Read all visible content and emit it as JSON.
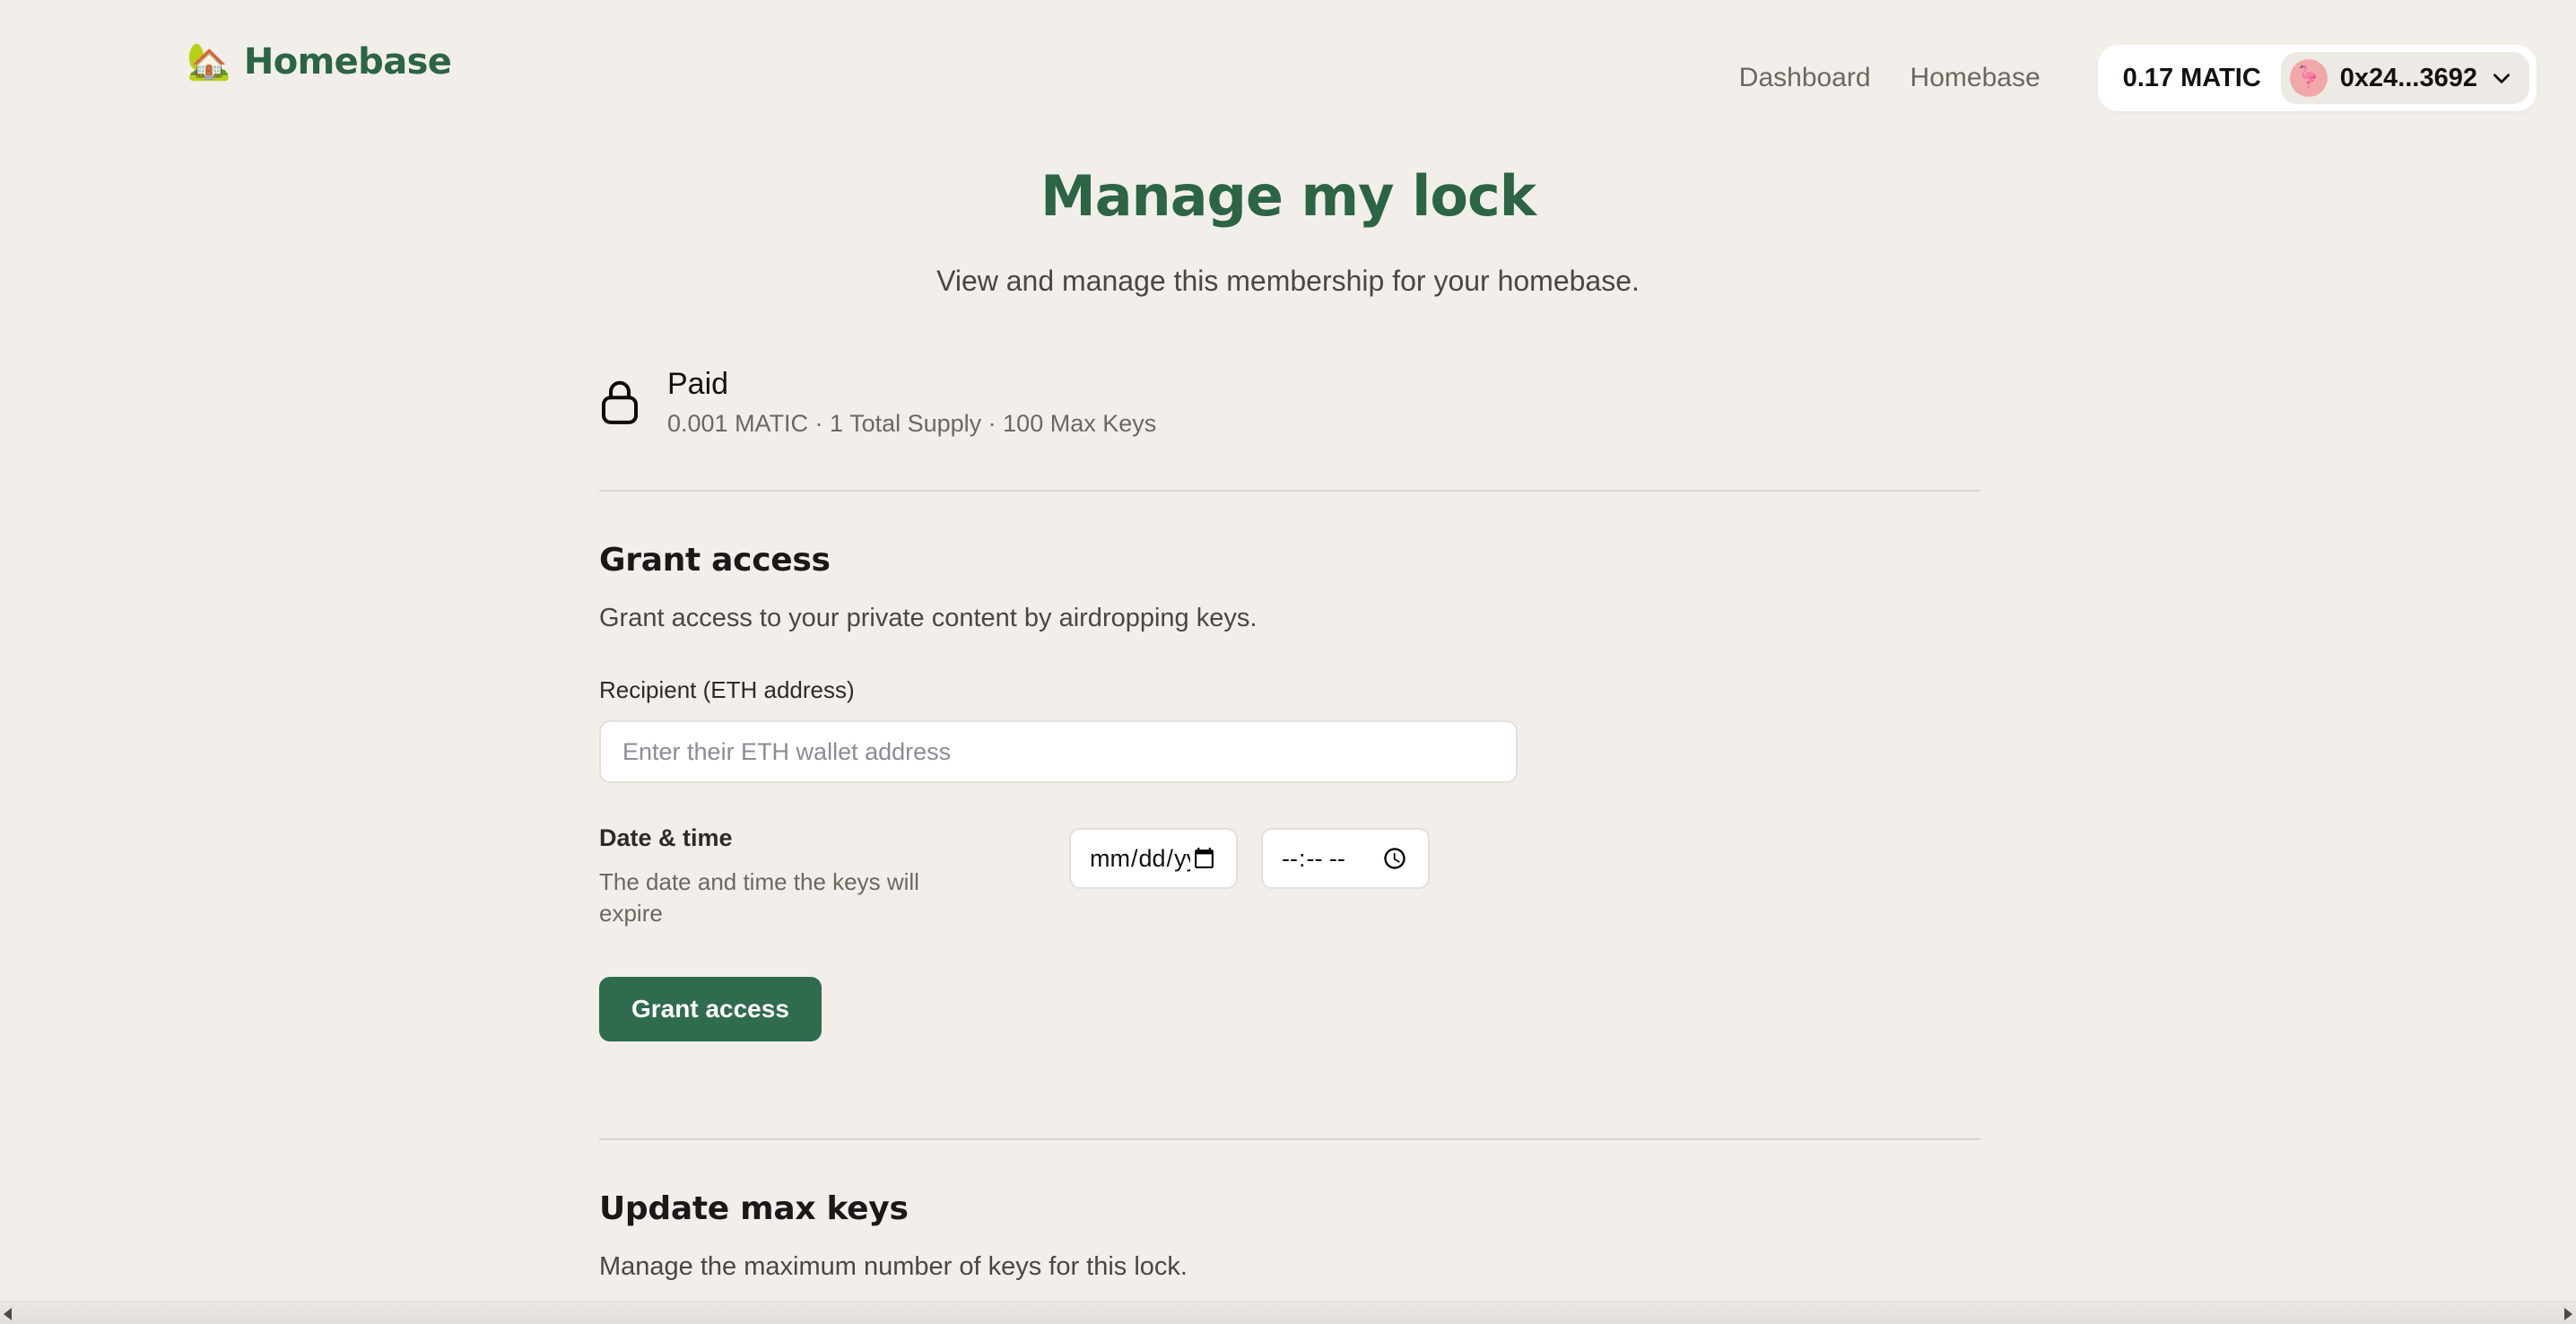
{
  "brand": {
    "emoji": "🏡",
    "emoji_name": "house-with-garden-emoji",
    "name": "Homebase"
  },
  "nav": {
    "links": [
      {
        "label": "Dashboard"
      },
      {
        "label": "Homebase"
      }
    ],
    "wallet": {
      "balance": "0.17 MATIC",
      "avatar_emoji": "🦩",
      "address": "0x24...3692",
      "chevron": "chevron-down-icon"
    }
  },
  "page": {
    "title": "Manage my lock",
    "subtitle": "View and manage this membership for your homebase."
  },
  "lock": {
    "icon": "lock-icon",
    "name": "Paid",
    "meta": "0.001 MATIC  ·  1 Total Supply ·  100 Max Keys",
    "price": "0.001 MATIC",
    "total_supply": "1 Total Supply",
    "max_keys": "100 Max Keys"
  },
  "grant_access": {
    "title": "Grant access",
    "description": "Grant access to your private content by airdropping keys.",
    "recipient_label": "Recipient (ETH address)",
    "recipient_value": "",
    "recipient_placeholder": "Enter their ETH wallet address",
    "datetime_label": "Date & time",
    "datetime_help": "The date and time the keys will expire",
    "date_placeholder": "mm/dd/yyyy",
    "time_placeholder": "--:-- --",
    "date_value": "",
    "time_value": "",
    "submit_label": "Grant access"
  },
  "update_max_keys": {
    "title": "Update max keys",
    "description": "Manage the maximum number of keys for this lock."
  },
  "colors": {
    "background": "#f2efeb",
    "brand_green": "#2c6446",
    "button_green": "#2f6b4f",
    "text_dark": "#14110f",
    "text_muted": "#6d6761",
    "avatar_pink": "#f0a8a8"
  }
}
